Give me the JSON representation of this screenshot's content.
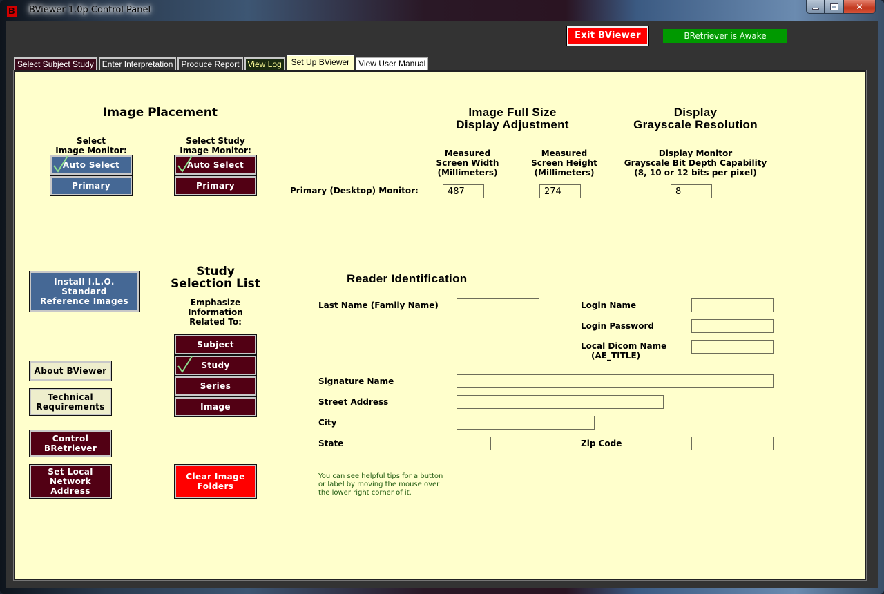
{
  "window": {
    "title": "BViewer 1.0p Control Panel",
    "app_icon_letter": "B"
  },
  "header": {
    "exit_label": "Exit BViewer",
    "status_text": "BRetriever is Awake",
    "colors": {
      "exit": "#ff0000",
      "status": "#009900",
      "panel_bg": "#ffffcc"
    }
  },
  "tabs": [
    {
      "label": "Select Subject Study",
      "active": false
    },
    {
      "label": "Enter Interpretation",
      "active": false
    },
    {
      "label": "Produce Report",
      "active": false
    },
    {
      "label": "View Log",
      "active": false
    },
    {
      "label": "Set Up BViewer",
      "active": true
    },
    {
      "label": "View User Manual",
      "active": false
    }
  ],
  "image_placement": {
    "title": "Image Placement",
    "image_monitor": {
      "label_line1": "Select",
      "label_line2": "Image Monitor:",
      "options": [
        {
          "label": "Auto Select",
          "checked": true
        },
        {
          "label": "Primary",
          "checked": false
        }
      ]
    },
    "study_monitor": {
      "label_line1": "Select Study",
      "label_line2": "Image Monitor:",
      "options": [
        {
          "label": "Auto Select",
          "checked": true
        },
        {
          "label": "Primary",
          "checked": false
        }
      ]
    }
  },
  "full_size": {
    "title_line1": "Image Full Size",
    "title_line2": "Display Adjustment",
    "width_label": [
      "Measured",
      "Screen Width",
      "(Millimeters)"
    ],
    "height_label": [
      "Measured",
      "Screen Height",
      "(Millimeters)"
    ],
    "row_label": "Primary (Desktop) Monitor:",
    "width_value": "487",
    "height_value": "274"
  },
  "grayscale": {
    "title_line1": "Display",
    "title_line2": "Grayscale Resolution",
    "label": [
      "Display Monitor",
      "Grayscale Bit Depth Capability",
      "(8, 10 or 12 bits per pixel)"
    ],
    "value": "8"
  },
  "left_buttons": {
    "install_ilo": [
      "Install I.L.O.",
      "Standard",
      "Reference Images"
    ],
    "about": "About BViewer",
    "tech_req": [
      "Technical",
      "Requirements"
    ],
    "control_bretriever": [
      "Control",
      "BRetriever"
    ],
    "set_network": [
      "Set Local",
      "Network",
      "Address"
    ]
  },
  "study_selection": {
    "title_line1": "Study",
    "title_line2": "Selection List",
    "subtitle": [
      "Emphasize",
      "Information",
      "Related To:"
    ],
    "options": [
      {
        "label": "Subject",
        "checked": false
      },
      {
        "label": "Study",
        "checked": true
      },
      {
        "label": "Series",
        "checked": false
      },
      {
        "label": "Image",
        "checked": false
      }
    ],
    "clear_folders": [
      "Clear Image",
      "Folders"
    ]
  },
  "reader_id": {
    "title": "Reader Identification",
    "last_name_label": "Last Name (Family Name)",
    "last_name_value": "",
    "login_name_label": "Login Name",
    "login_name_value": "",
    "login_password_label": "Login Password",
    "login_password_value": "",
    "dicom_name_label_line1": "Local Dicom Name",
    "dicom_name_label_line2": "(AE_TITLE)",
    "dicom_name_value": "",
    "signature_label": "Signature Name",
    "signature_value": "",
    "street_label": "Street Address",
    "street_value": "",
    "city_label": "City",
    "city_value": "",
    "state_label": "State",
    "state_value": "",
    "zip_label": "Zip Code",
    "zip_value": ""
  },
  "tip": [
    "You can see helpful tips for a button",
    "or label by moving the mouse over",
    "the lower right corner of it."
  ]
}
